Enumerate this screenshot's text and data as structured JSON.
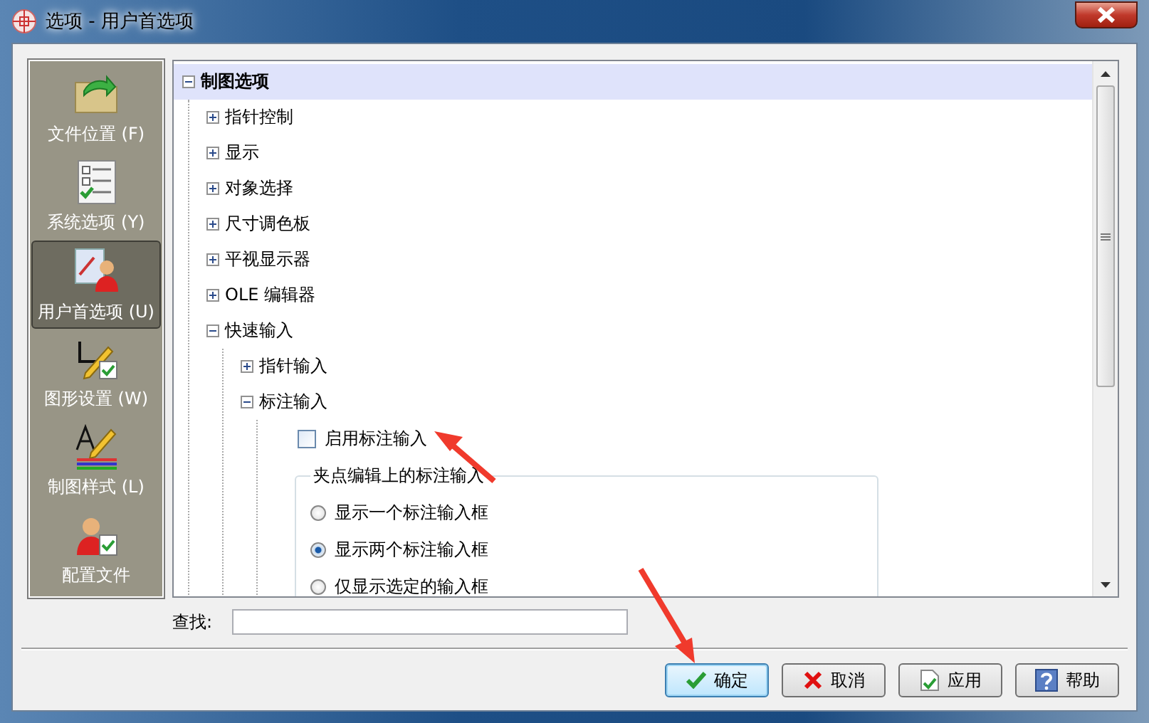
{
  "window": {
    "title": "选项 - 用户首选项"
  },
  "sidebar": {
    "items": [
      {
        "label": "文件位置 (F)",
        "selected": false
      },
      {
        "label": "系统选项 (Y)",
        "selected": false
      },
      {
        "label": "用户首选项 (U)",
        "selected": true
      },
      {
        "label": "图形设置 (W)",
        "selected": false
      },
      {
        "label": "制图样式 (L)",
        "selected": false
      },
      {
        "label": "配置文件",
        "selected": false
      }
    ]
  },
  "tree": {
    "label": "制图选项",
    "selected": true,
    "expanded": true,
    "children": [
      {
        "kind": "node",
        "label": "指针控制",
        "expanded": false
      },
      {
        "kind": "node",
        "label": "显示",
        "expanded": false
      },
      {
        "kind": "node",
        "label": "对象选择",
        "expanded": false
      },
      {
        "kind": "node",
        "label": "尺寸调色板",
        "expanded": false
      },
      {
        "kind": "node",
        "label": "平视显示器",
        "expanded": false
      },
      {
        "kind": "node",
        "label": "OLE 编辑器",
        "expanded": false
      },
      {
        "kind": "node",
        "label": "快速输入",
        "expanded": true,
        "children": [
          {
            "kind": "node",
            "label": "指针输入",
            "expanded": false
          },
          {
            "kind": "node",
            "label": "标注输入",
            "expanded": true,
            "children": [
              {
                "kind": "checkbox",
                "label": "启用标注输入",
                "checked": false
              },
              {
                "kind": "group",
                "title": "夹点编辑上的标注输入",
                "options": [
                  {
                    "label": "显示一个标注输入框",
                    "selected": false
                  },
                  {
                    "label": "显示两个标注输入框",
                    "selected": true
                  },
                  {
                    "label": "仅显示选定的输入框",
                    "selected": false
                  }
                ]
              }
            ]
          }
        ]
      }
    ]
  },
  "find": {
    "label": "查找:"
  },
  "buttons": [
    {
      "kind": "ok",
      "label": "确定",
      "focused": true
    },
    {
      "kind": "cancel",
      "label": "取消",
      "focused": false
    },
    {
      "kind": "apply",
      "label": "应用",
      "focused": false
    },
    {
      "kind": "help",
      "label": "帮助",
      "focused": false
    }
  ]
}
